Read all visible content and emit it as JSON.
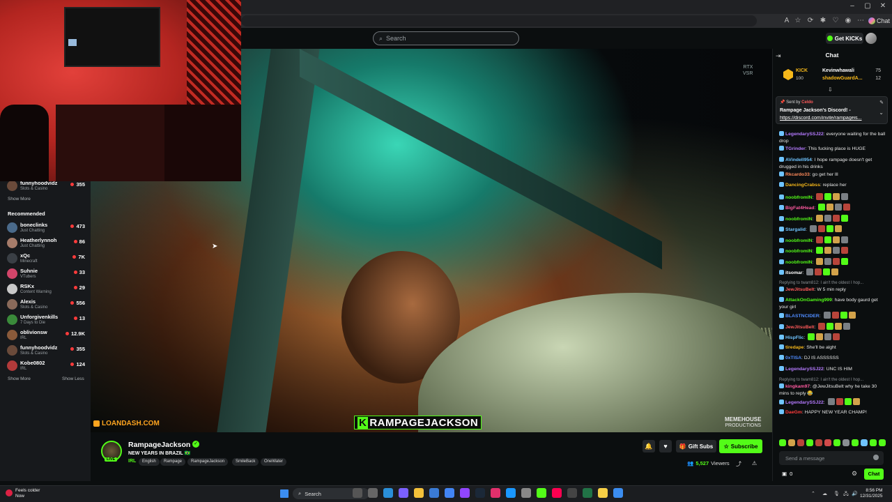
{
  "browser": {
    "window_controls": [
      "–",
      "▢",
      "✕"
    ],
    "chat_button": "Chat"
  },
  "nav": {
    "search_placeholder": "Search",
    "get_kicks": "Get KICKs"
  },
  "sidebar": {
    "top_item": {
      "name": "funnyhoodvidz",
      "category": "Slots & Casino",
      "viewers": "355"
    },
    "show_more_1": "Show More",
    "recommended_label": "Recommended",
    "items": [
      {
        "name": "boneclinks",
        "category": "Just Chatting",
        "viewers": "473",
        "color": "#4a6a8a"
      },
      {
        "name": "Heatherlynnoh",
        "category": "Just Chatting",
        "viewers": "86",
        "color": "#a67c6a"
      },
      {
        "name": "xQc",
        "category": "Minecraft",
        "viewers": "7K",
        "color": "#3a3f45"
      },
      {
        "name": "Suhnie",
        "category": "VTubers",
        "viewers": "33",
        "color": "#d2456a"
      },
      {
        "name": "RSKx",
        "category": "Content Warning",
        "viewers": "29",
        "color": "#c9c9c9"
      },
      {
        "name": "Alexis",
        "category": "Slots & Casino",
        "viewers": "556",
        "color": "#8a6a5a"
      },
      {
        "name": "Unforgivenkills",
        "category": "7 Days to Die",
        "viewers": "13",
        "color": "#3a8a3a"
      },
      {
        "name": "oblivionsw",
        "category": "IRL",
        "viewers": "12.9K",
        "color": "#8a5a3a"
      },
      {
        "name": "funnyhoodvidz",
        "category": "Slots & Casino",
        "viewers": "355",
        "color": "#6a4a3a"
      },
      {
        "name": "Kobe0802",
        "category": "IRL",
        "viewers": "124",
        "color": "#b23a3a"
      }
    ],
    "show_more_2": "Show More",
    "show_less": "Show Less"
  },
  "video": {
    "rtx_label_1": "RTX",
    "rtx_label_2": "VSR",
    "sponsor": "LOANDASH.COM",
    "watermark_1": "MEMEHOUSE",
    "watermark_2": "PRODUCTIONS",
    "overlay_k": "K",
    "overlay_name": "RAMPAGEJACKSON"
  },
  "stream": {
    "streamer": "RampageJackson",
    "title": "NEW YEARS IN BRAZIL 🇧🇷",
    "live_badge": "LIVE",
    "category": "IRL",
    "tags": [
      "English",
      "Rampage",
      "RampageJackson",
      "SmileBack",
      "OneWater"
    ],
    "gift_subs": "Gift Subs",
    "subscribe": "Subscribe",
    "viewers_count": "5,527",
    "viewers_label": "Viewers"
  },
  "chat": {
    "header": "Chat",
    "leaderboard": {
      "kick_label": "KICK",
      "kick_amount": "100",
      "entries": [
        {
          "user": "Kevinwhawali",
          "count": "75",
          "color": "#ffffff"
        },
        {
          "user": "shadowGuardA...",
          "count": "12",
          "color": "#f6b81a"
        }
      ]
    },
    "pinned": {
      "sent_by_label": "Sent by",
      "sent_by_user": "Celdo",
      "message": "Rampage Jackson's Discord! -",
      "link": "https://discord.com/invite/rampageis..."
    },
    "messages": [
      {
        "user": "LegendarySSJ22",
        "color": "#b57aff",
        "text": "everyone waiting for the ball drop"
      },
      {
        "user": "TGrinder",
        "color": "#b57aff",
        "text": "This fucking place is HUGE"
      },
      {
        "user": "AVindell954",
        "color": "#6fc4ff",
        "text": "I hope rampage doesn't get drugged in his drinks"
      },
      {
        "user": "Rkcardo33",
        "color": "#ff8a5a",
        "text": "go get her lll"
      },
      {
        "user": "DancingCrabss",
        "color": "#f6b81a",
        "text": "replace her"
      },
      {
        "user": "noobfromIN",
        "color": "#53fc18",
        "text": ""
      },
      {
        "user": "BigFat4Head",
        "color": "#ff5aa0",
        "text": ""
      },
      {
        "user": "noobfromIN",
        "color": "#53fc18",
        "text": ""
      },
      {
        "user": "Stargalid",
        "color": "#6fc4ff",
        "text": ""
      },
      {
        "user": "noobfromIN",
        "color": "#53fc18",
        "text": ""
      },
      {
        "user": "noobfromIN",
        "color": "#53fc18",
        "text": ""
      },
      {
        "user": "noobfromIN",
        "color": "#53fc18",
        "text": ""
      },
      {
        "user": "itsomar",
        "color": "#ffffff",
        "text": ""
      },
      {
        "reply": "Replying to twam812: I ain't the oldest I hop..."
      },
      {
        "user": "JewJitsuBelt",
        "color": "#ff5a5a",
        "text": "W 5 min reply"
      },
      {
        "user": "AttackOnGaming999",
        "color": "#53fc18",
        "text": "have body gaurd get your girl"
      },
      {
        "user": "BLASTNCIDER",
        "color": "#4f8cff",
        "text": ""
      },
      {
        "user": "JewJitsuBelt",
        "color": "#ff5a5a",
        "text": ""
      },
      {
        "user": "HispFlic",
        "color": "#6fc4ff",
        "text": ""
      },
      {
        "user": "tiredape",
        "color": "#f6b81a",
        "text": "She'll be alght"
      },
      {
        "user": "0xTISA",
        "color": "#4f8cff",
        "text": "DJ IS ASSSSSS"
      },
      {
        "user": "LegendarySSJ22",
        "color": "#b57aff",
        "text": "UNC IS HIM"
      },
      {
        "reply": "Replying to twam812: I ain't the oldest I hop..."
      },
      {
        "user": "kingkam97",
        "color": "#ff5aa0",
        "text": "@JewJitsuBelt why he take 30 mins to reply 😂"
      },
      {
        "user": "LegendarySSJ22",
        "color": "#b57aff",
        "text": ""
      },
      {
        "user": "DaeGm",
        "color": "#ff3b3b",
        "text": "HAPPY NEW YEAR CHAMP!"
      }
    ],
    "input_placeholder": "Send a message",
    "send_label": "Chat",
    "points": "0"
  },
  "taskbar": {
    "weather_line1": "Feels colder",
    "weather_line2": "Now",
    "search_placeholder": "Search",
    "time": "8:56 PM",
    "date": "12/31/2025"
  }
}
